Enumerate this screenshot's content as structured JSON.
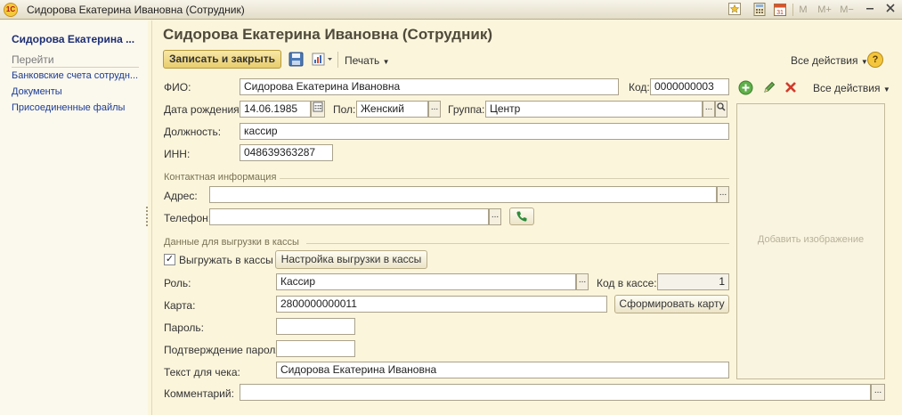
{
  "window": {
    "title": "Сидорова Екатерина Ивановна (Сотрудник)",
    "logo": "1С",
    "m_buttons": [
      "M",
      "M+",
      "M−"
    ],
    "calendar_day": "31"
  },
  "left_panel": {
    "header": "Сидорова Екатерина ...",
    "go_label": "Перейти",
    "links": [
      "Банковские счета сотрудн...",
      "Документы",
      "Присоединенные файлы"
    ]
  },
  "main": {
    "title": "Сидорова Екатерина Ивановна (Сотрудник)",
    "toolbar": {
      "save_close": "Записать и закрыть",
      "print": "Печать",
      "all_actions": "Все действия",
      "help": "?"
    },
    "form": {
      "fio_label": "ФИО:",
      "fio_value": "Сидорова Екатерина Ивановна",
      "code_label": "Код:",
      "code_value": "0000000003",
      "birth_label": "Дата рождения:",
      "birth_value": "14.06.1985",
      "gender_label": "Пол:",
      "gender_value": "Женский",
      "group_label": "Группа:",
      "group_value": "Центр",
      "position_label": "Должность:",
      "position_value": "кассир",
      "inn_label": "ИНН:",
      "inn_value": "048639363287"
    },
    "contact": {
      "title": "Контактная информация",
      "address_label": "Адрес:",
      "address_value": "",
      "phone_label": "Телефон:",
      "phone_value": ""
    },
    "cash": {
      "title": "Данные для выгрузки в кассы",
      "export_checkbox": "Выгружать в кассы",
      "export_checked": true,
      "setup_button": "Настройка выгрузки в кассы",
      "role_label": "Роль:",
      "role_value": "Кассир",
      "code_in_cash_label": "Код в кассе:",
      "code_in_cash_value": "1",
      "card_label": "Карта:",
      "card_value": "2800000000011",
      "form_card_button": "Сформировать карту",
      "password_label": "Пароль:",
      "password_value": "",
      "confirm_label": "Подтверждение пароля:",
      "confirm_value": "",
      "receipt_label": "Текст для чека:",
      "receipt_value": "Сидорова Екатерина Ивановна"
    },
    "comment_label": "Комментарий:",
    "comment_value": "",
    "image": {
      "all_actions": "Все действия",
      "add_image": "Добавить изображение"
    }
  }
}
